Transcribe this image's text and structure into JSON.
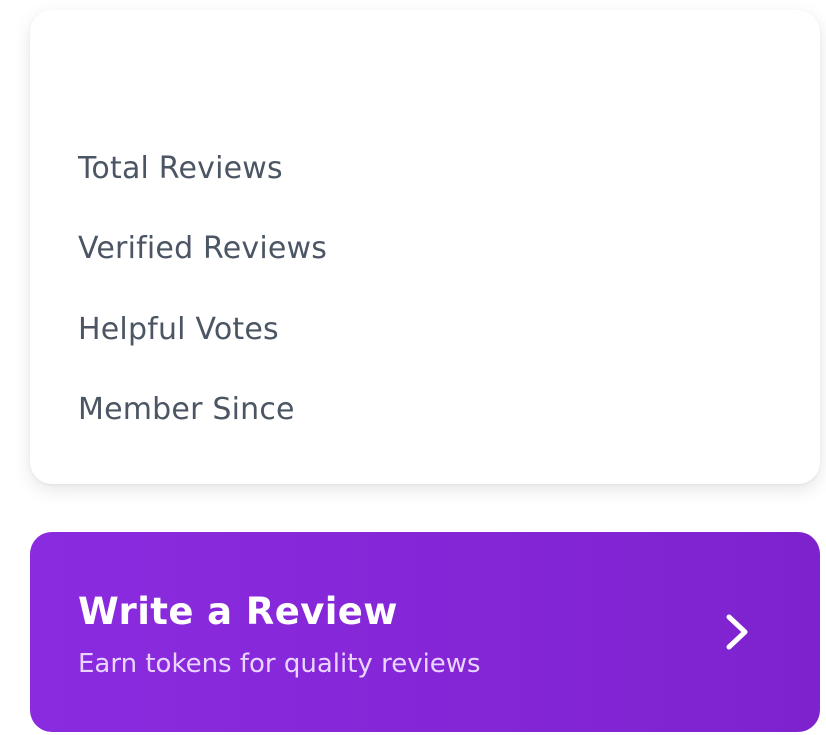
{
  "stats": {
    "items": [
      {
        "label": "Total Reviews",
        "value": ""
      },
      {
        "label": "Verified Reviews",
        "value": ""
      },
      {
        "label": "Helpful Votes",
        "value": ""
      },
      {
        "label": "Member Since",
        "value": ""
      }
    ]
  },
  "cta": {
    "title": "Write a Review",
    "subtitle": "Earn tokens for quality reviews",
    "icon": "chevron-right-icon",
    "gradient_start": "#8b2be0",
    "gradient_end": "#7e22ce"
  }
}
